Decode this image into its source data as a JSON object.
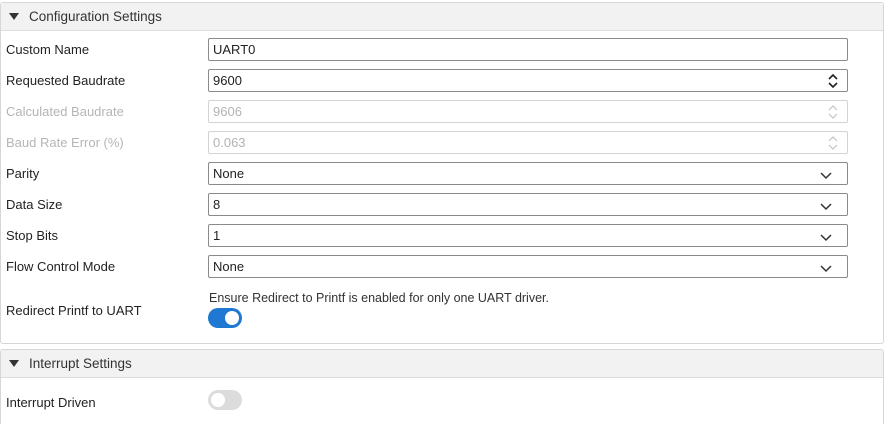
{
  "config": {
    "title": "Configuration Settings",
    "custom_name": {
      "label": "Custom Name",
      "value": "UART0"
    },
    "requested_baudrate": {
      "label": "Requested Baudrate",
      "value": "9600"
    },
    "calculated_baudrate": {
      "label": "Calculated Baudrate",
      "value": "9606"
    },
    "baud_rate_error": {
      "label": "Baud Rate Error (%)",
      "value": "0.063"
    },
    "parity": {
      "label": "Parity",
      "value": "None"
    },
    "data_size": {
      "label": "Data Size",
      "value": "8"
    },
    "stop_bits": {
      "label": "Stop Bits",
      "value": "1"
    },
    "flow_control": {
      "label": "Flow Control Mode",
      "value": "None"
    },
    "redirect_printf": {
      "label": "Redirect Printf to UART",
      "note": "Ensure Redirect to Printf is enabled for only one UART driver.",
      "enabled": true
    }
  },
  "interrupt": {
    "title": "Interrupt Settings",
    "interrupt_driven": {
      "label": "Interrupt Driven",
      "enabled": false
    }
  },
  "colors": {
    "accent": "#1f78d1",
    "toggle_off": "#dcdcdc"
  }
}
